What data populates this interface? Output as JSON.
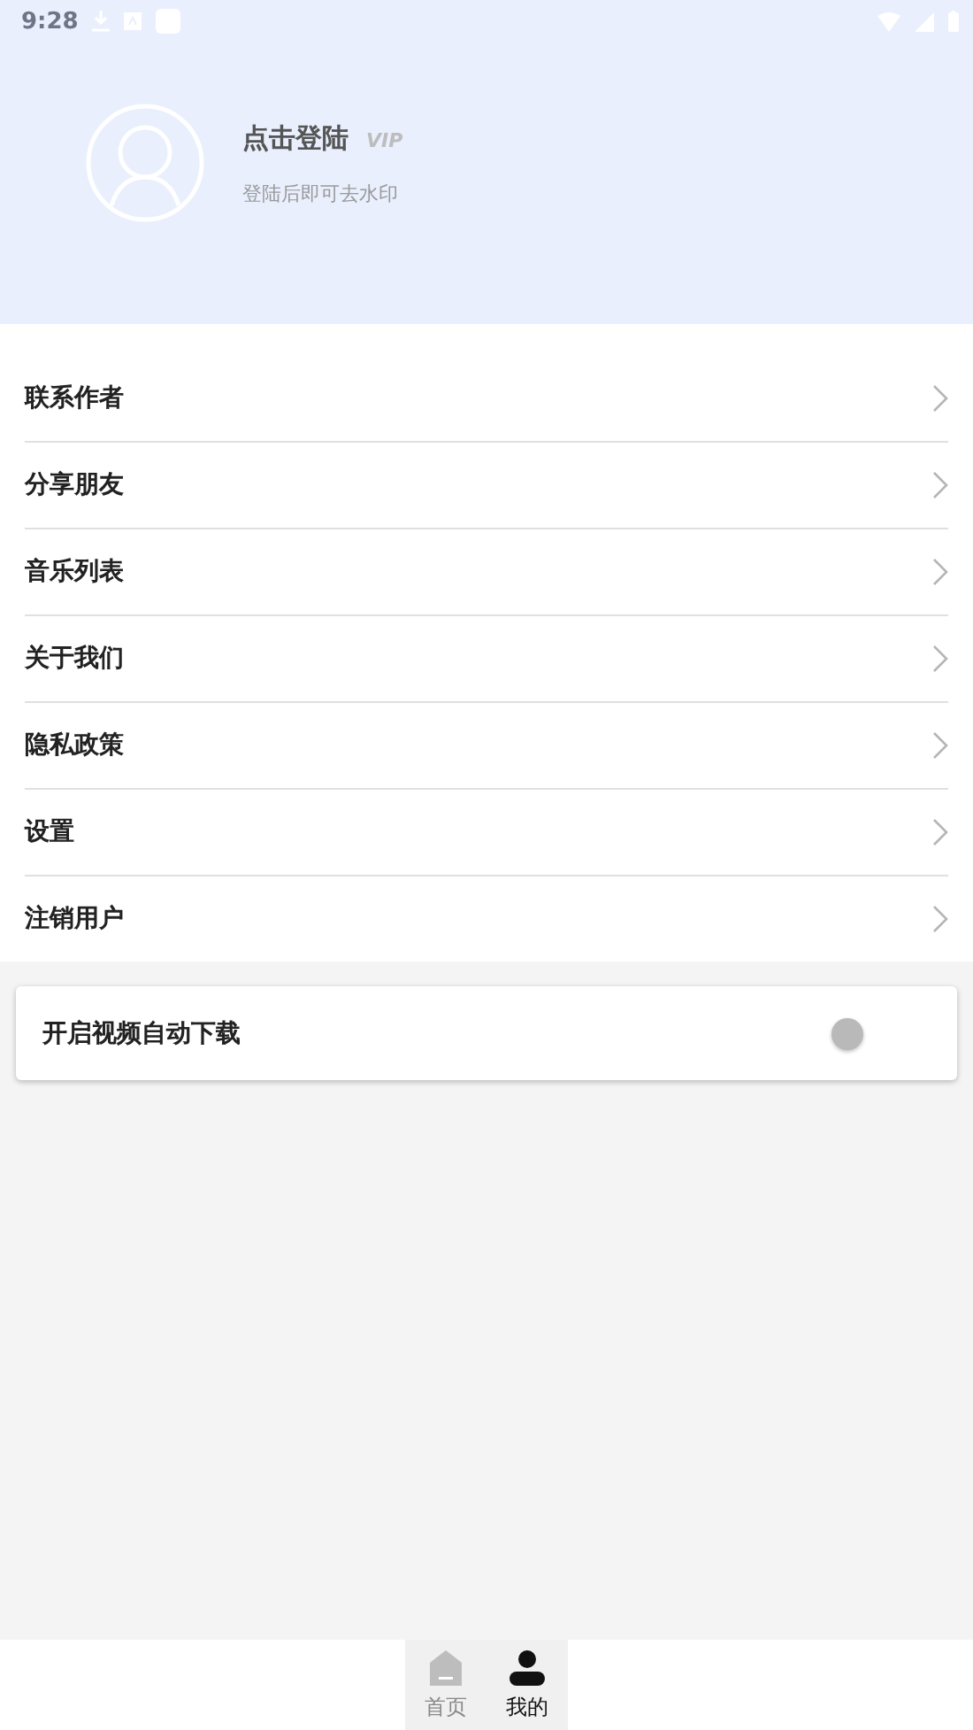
{
  "status_bar": {
    "time": "9:28"
  },
  "profile": {
    "title": "点击登陆",
    "vip_badge": "VIP",
    "vip_active": false,
    "subtitle": "登陆后即可去水印"
  },
  "menu": [
    {
      "label": "联系作者"
    },
    {
      "label": "分享朋友"
    },
    {
      "label": "音乐列表"
    },
    {
      "label": "关于我们"
    },
    {
      "label": "隐私政策"
    },
    {
      "label": "设置"
    },
    {
      "label": "注销用户"
    }
  ],
  "auto_download": {
    "label": "开启视频自动下载",
    "on": false
  },
  "bottom_nav": [
    {
      "label": "首页",
      "kind": "home",
      "selected": false
    },
    {
      "label": "我的",
      "kind": "person",
      "selected": true
    }
  ]
}
